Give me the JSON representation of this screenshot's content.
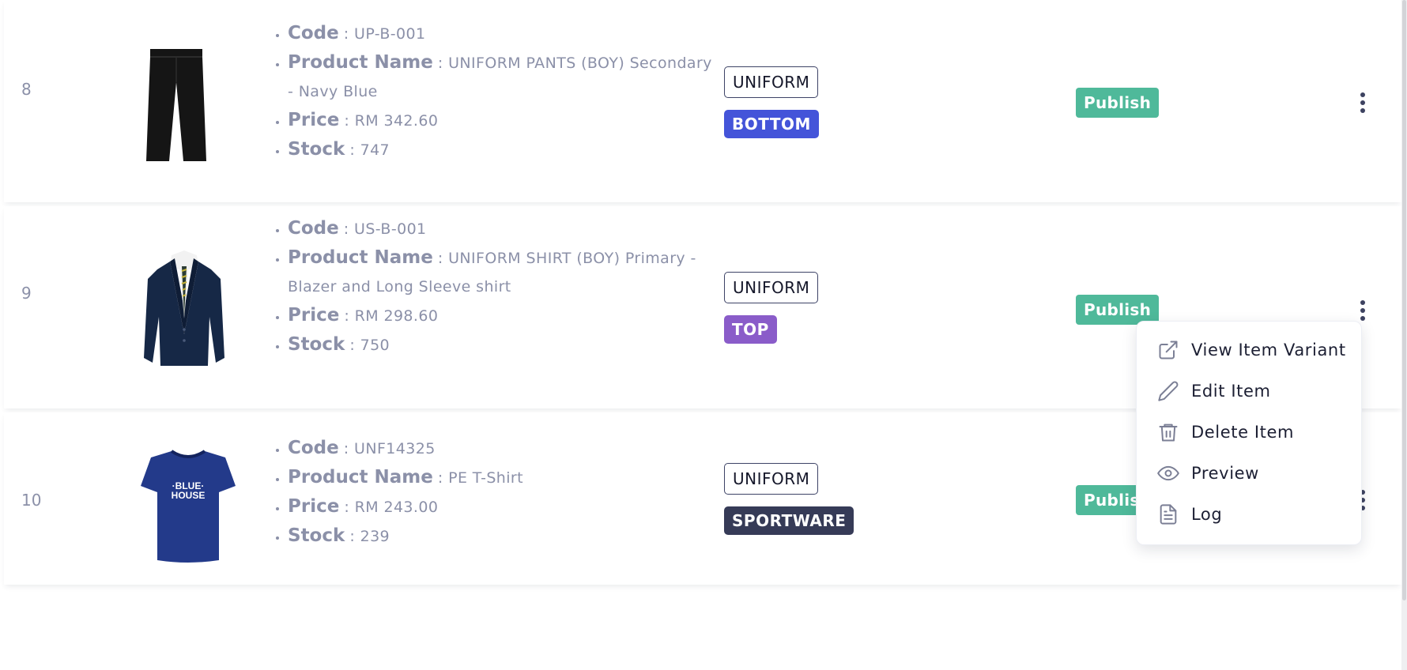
{
  "colors": {
    "publish": "#4fb99a",
    "bottom_tag": "#4454d9",
    "top_tag": "#8a5cc9",
    "sportware_tag": "#363b57"
  },
  "rows": [
    {
      "number": "8",
      "code_label": "Code",
      "code": ": UP-B-001",
      "name_label": "Product Name",
      "name": ": UNIFORM PANTS (BOY) Secondary - Navy Blue",
      "price_label": "Price",
      "price": ": RM 342.60",
      "stock_label": "Stock",
      "stock": ": 747",
      "tag_type": "UNIFORM",
      "tag_category": "BOTTOM",
      "status": "Publish",
      "image_icon": "pants-icon"
    },
    {
      "number": "9",
      "code_label": "Code",
      "code": ": US-B-001",
      "name_label": "Product Name",
      "name": ": UNIFORM SHIRT (BOY) Primary - Blazer and Long Sleeve shirt",
      "price_label": "Price",
      "price": ": RM 298.60",
      "stock_label": "Stock",
      "stock": ": 750",
      "tag_type": "UNIFORM",
      "tag_category": "TOP",
      "status": "Publish",
      "image_icon": "blazer-icon"
    },
    {
      "number": "10",
      "code_label": "Code",
      "code": ": UNF14325",
      "name_label": "Product Name",
      "name": ": PE T-Shirt",
      "price_label": "Price",
      "price": ": RM 243.00",
      "stock_label": "Stock",
      "stock": ": 239",
      "tag_type": "UNIFORM",
      "tag_category": "SPORTWARE",
      "status": "Publish",
      "image_icon": "tshirt-icon",
      "image_text_1": "·BLUE·",
      "image_text_2": "HOUSE"
    }
  ],
  "context_menu": {
    "items": [
      {
        "label": "View Item Variant",
        "icon": "external-link-icon"
      },
      {
        "label": "Edit Item",
        "icon": "pencil-icon"
      },
      {
        "label": "Delete Item",
        "icon": "trash-icon"
      },
      {
        "label": "Preview",
        "icon": "eye-icon"
      },
      {
        "label": "Log",
        "icon": "document-icon"
      }
    ]
  }
}
